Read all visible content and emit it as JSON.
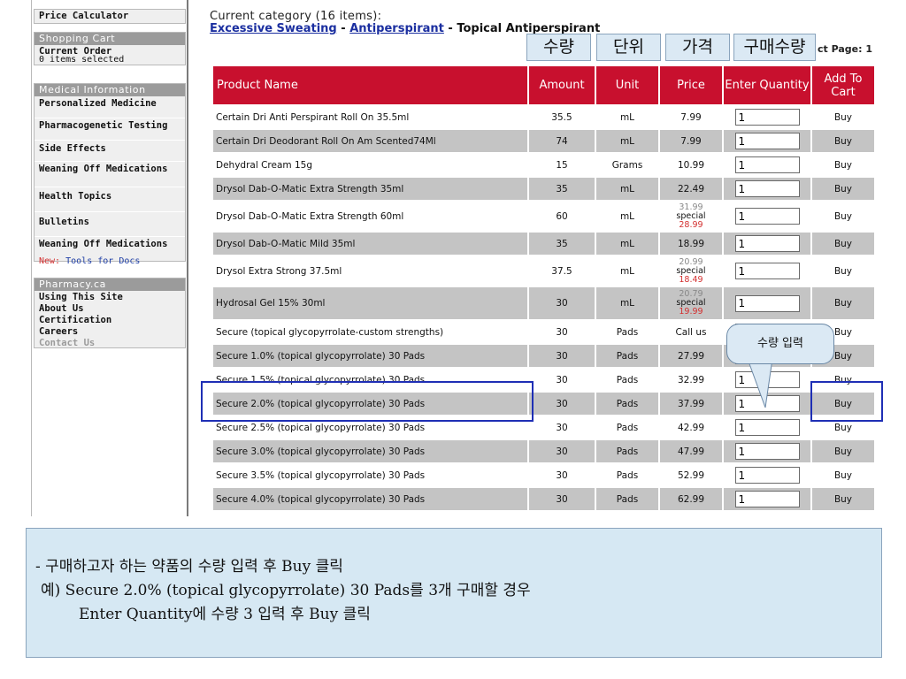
{
  "sidebar": {
    "price_calculator": "Price Calculator",
    "shopping_cart": {
      "title": "Shopping Cart",
      "current_order": "Current Order",
      "items_selected": "0 items selected"
    },
    "medical": {
      "title": "Medical Information",
      "items": [
        "Personalized Medicine",
        "Pharmacogenetic Testing",
        "Side Effects",
        "Weaning Off Medications",
        "Health Topics",
        "Bulletins",
        "Weaning Off Medications"
      ],
      "new_label": "New:",
      "new_link": "Tools for Docs"
    },
    "pharmacy": {
      "title": "Pharmacy.ca",
      "items": [
        "Using This Site",
        "About Us",
        "Certification",
        "Careers",
        "Contact Us"
      ]
    }
  },
  "header": {
    "current_category": "Current category (16 items):",
    "crumb1": "Excessive Sweating",
    "crumb_sep": " - ",
    "crumb2": "Antiperspirant",
    "crumb3": "Topical Antiperspirant",
    "page_label": "ct Page: 1"
  },
  "callouts": {
    "qty": "수량",
    "unit": "단위",
    "price": "가격",
    "buy_qty": "구매수량",
    "enter_qty": "수량 입력"
  },
  "table": {
    "headers": {
      "name": "Product Name",
      "amount": "Amount",
      "unit": "Unit",
      "price": "Price",
      "enter_qty": "Enter Quantity",
      "add_to_cart": "Add To Cart"
    },
    "buy_label": "Buy",
    "default_qty": "1",
    "rows": [
      {
        "name": "Certain Dri Anti Perspirant Roll On 35.5ml",
        "amount": "35.5",
        "unit": "mL",
        "price": "7.99"
      },
      {
        "name": "Certain Dri Deodorant Roll On Am Scented74Ml",
        "amount": "74",
        "unit": "mL",
        "price": "7.99"
      },
      {
        "name": "Dehydral Cream 15g",
        "amount": "15",
        "unit": "Grams",
        "price": "10.99"
      },
      {
        "name": "Drysol Dab-O-Matic Extra Strength 35ml",
        "amount": "35",
        "unit": "mL",
        "price": "22.49"
      },
      {
        "name": "Drysol Dab-O-Matic Extra Strength 60ml",
        "amount": "60",
        "unit": "mL",
        "price_old": "31.99",
        "price_special": "special",
        "price_new": "28.99"
      },
      {
        "name": "Drysol Dab-O-Matic Mild 35ml",
        "amount": "35",
        "unit": "mL",
        "price": "18.99"
      },
      {
        "name": "Drysol Extra Strong 37.5ml",
        "amount": "37.5",
        "unit": "mL",
        "price_old": "20.99",
        "price_special": "special",
        "price_new": "18.49"
      },
      {
        "name": "Hydrosal Gel 15% 30ml",
        "amount": "30",
        "unit": "mL",
        "price_old": "20.79",
        "price_special": "special",
        "price_new": "19.99"
      },
      {
        "name": "Secure (topical glycopyrrolate-custom strengths)",
        "amount": "30",
        "unit": "Pads",
        "price": "Call us"
      },
      {
        "name": "Secure 1.0% (topical glycopyrrolate) 30 Pads",
        "amount": "30",
        "unit": "Pads",
        "price": "27.99"
      },
      {
        "name": "Secure 1.5% (topical glycopyrrolate) 30 Pads",
        "amount": "30",
        "unit": "Pads",
        "price": "32.99"
      },
      {
        "name": "Secure 2.0% (topical glycopyrrolate) 30 Pads",
        "amount": "30",
        "unit": "Pads",
        "price": "37.99"
      },
      {
        "name": "Secure 2.5% (topical glycopyrrolate) 30 Pads",
        "amount": "30",
        "unit": "Pads",
        "price": "42.99"
      },
      {
        "name": "Secure 3.0% (topical glycopyrrolate) 30 Pads",
        "amount": "30",
        "unit": "Pads",
        "price": "47.99"
      },
      {
        "name": "Secure 3.5% (topical glycopyrrolate) 30 Pads",
        "amount": "30",
        "unit": "Pads",
        "price": "52.99"
      },
      {
        "name": "Secure 4.0% (topical glycopyrrolate) 30 Pads",
        "amount": "30",
        "unit": "Pads",
        "price": "62.99"
      }
    ]
  },
  "note": {
    "line1": "- 구매하고자 하는 약품의 수량 입력 후 Buy 클릭",
    "line2": "예) Secure 2.0% (topical glycopyrrolate) 30 Pads를 3개 구매할 경우",
    "line3": "Enter Quantity에 수량 3 입력 후 Buy 클릭"
  },
  "colors": {
    "header_red": "#c8102e",
    "highlight_blue": "#1f2fb5",
    "callout_bg": "#dbe9f4"
  }
}
